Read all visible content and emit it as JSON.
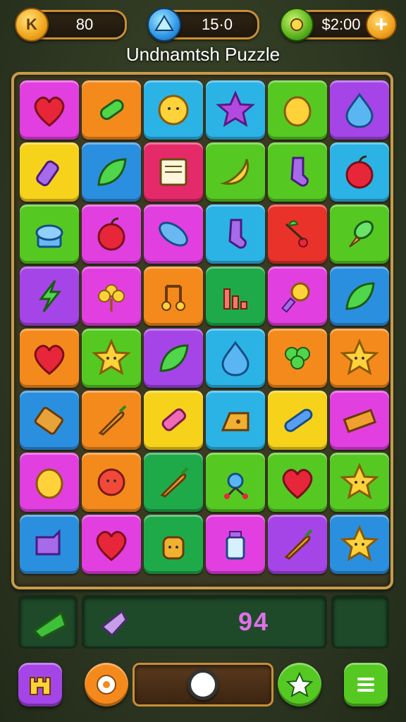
{
  "header": {
    "currencies": [
      {
        "icon": "coin-k-icon",
        "value": "80"
      },
      {
        "icon": "blue-gem-icon",
        "value": "15·0"
      },
      {
        "icon": "green-orb-icon",
        "value": "$2:00"
      }
    ],
    "add_label": "+",
    "coin_letter": "K"
  },
  "title": "Undnamtsh Puzzle",
  "board": {
    "tiles": [
      {
        "icon": "heart-icon",
        "bg": "#e23fe0"
      },
      {
        "icon": "candy-stick-icon",
        "bg": "#f58a1c"
      },
      {
        "icon": "sun-flower-icon",
        "bg": "#2bb3e6"
      },
      {
        "icon": "star-icon",
        "bg": "#2bb3e6"
      },
      {
        "icon": "lemon-icon",
        "bg": "#55c922"
      },
      {
        "icon": "water-drop-icon",
        "bg": "#a545e8"
      },
      {
        "icon": "bottle-icon",
        "bg": "#f7d21b"
      },
      {
        "icon": "leaf-icon",
        "bg": "#2b8fe0"
      },
      {
        "icon": "scroll-icon",
        "bg": "#e52a6a"
      },
      {
        "icon": "banana-face-icon",
        "bg": "#55c922"
      },
      {
        "icon": "sock-icon",
        "bg": "#55c922"
      },
      {
        "icon": "apple-icon",
        "bg": "#2bb3e6"
      },
      {
        "icon": "cupcake-icon",
        "bg": "#55c922"
      },
      {
        "icon": "apple-icon",
        "bg": "#e23fe0"
      },
      {
        "icon": "blue-leaf-icon",
        "bg": "#e23fe0"
      },
      {
        "icon": "sock-icon",
        "bg": "#2bb3e6"
      },
      {
        "icon": "cherry-branch-icon",
        "bg": "#e8322a"
      },
      {
        "icon": "ice-cream-icon",
        "bg": "#55c922"
      },
      {
        "icon": "lightning-icon",
        "bg": "#a545e8"
      },
      {
        "icon": "flower-icon",
        "bg": "#e23fe0"
      },
      {
        "icon": "music-note-icon",
        "bg": "#f58a1c"
      },
      {
        "icon": "chart-bars-icon",
        "bg": "#1faa4a"
      },
      {
        "icon": "torch-icon",
        "bg": "#e23fe0"
      },
      {
        "icon": "leaf-icon",
        "bg": "#2b8fe0"
      },
      {
        "icon": "heart-icon",
        "bg": "#f58a1c"
      },
      {
        "icon": "star-face-icon",
        "bg": "#55c922"
      },
      {
        "icon": "leaf-icon",
        "bg": "#a545e8"
      },
      {
        "icon": "water-drop-icon",
        "bg": "#2bb3e6"
      },
      {
        "icon": "clover-icon",
        "bg": "#f58a1c"
      },
      {
        "icon": "star-face-icon",
        "bg": "#f58a1c"
      },
      {
        "icon": "cracker-icon",
        "bg": "#2b8fe0"
      },
      {
        "icon": "carrot-icon",
        "bg": "#f58a1c"
      },
      {
        "icon": "marker-icon",
        "bg": "#f7d21b"
      },
      {
        "icon": "cheese-icon",
        "bg": "#2bb3e6"
      },
      {
        "icon": "crayon-icon",
        "bg": "#f7d21b"
      },
      {
        "icon": "ruler-icon",
        "bg": "#e23fe0"
      },
      {
        "icon": "lemon-icon",
        "bg": "#e23fe0"
      },
      {
        "icon": "flower-face-icon",
        "bg": "#f58a1c"
      },
      {
        "icon": "carrot-icon",
        "bg": "#1faa4a"
      },
      {
        "icon": "molecule-icon",
        "bg": "#55c922"
      },
      {
        "icon": "heart-icon",
        "bg": "#55c922"
      },
      {
        "icon": "star-face-icon",
        "bg": "#55c922"
      },
      {
        "icon": "speech-bubble-icon",
        "bg": "#2b8fe0"
      },
      {
        "icon": "heart-icon",
        "bg": "#e23fe0"
      },
      {
        "icon": "honey-pot-icon",
        "bg": "#1faa4a"
      },
      {
        "icon": "jar-icon",
        "bg": "#e23fe0"
      },
      {
        "icon": "carrot-icon",
        "bg": "#a545e8"
      },
      {
        "icon": "star-face-icon",
        "bg": "#2b8fe0"
      }
    ]
  },
  "tray": {
    "left_icon": "green-leaf-icon",
    "middle_icon": "crystal-icon",
    "score": "94"
  },
  "controls": {
    "slider_level": 0.5,
    "buttons": [
      {
        "icon": "castle-icon",
        "bg": "#a545e8"
      },
      {
        "icon": "settings-gear-icon",
        "bg": "#f58a1c"
      },
      {
        "icon": "star-icon",
        "bg": "#55c922"
      },
      {
        "icon": "menu-icon",
        "bg": "#55c922"
      }
    ]
  }
}
